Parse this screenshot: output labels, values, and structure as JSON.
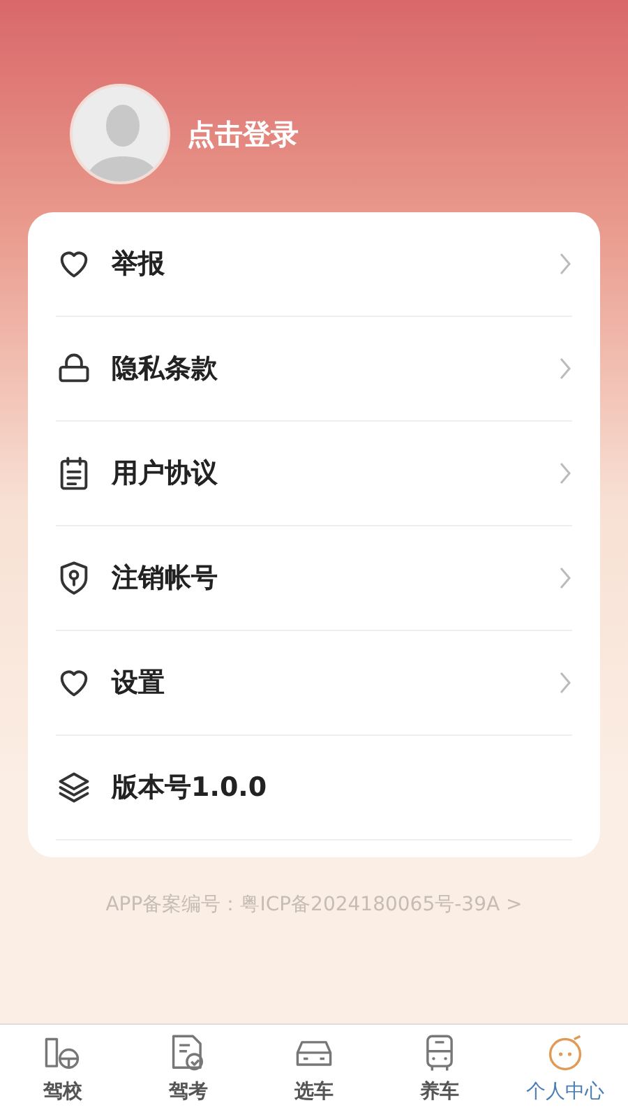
{
  "profile": {
    "login_label": "点击登录"
  },
  "menu": [
    {
      "kind": "heart",
      "label": "举报",
      "chevron": true
    },
    {
      "kind": "lock",
      "label": "隐私条款",
      "chevron": true
    },
    {
      "kind": "clipboard",
      "label": "用户协议",
      "chevron": true
    },
    {
      "kind": "shield",
      "label": "注销帐号",
      "chevron": true
    },
    {
      "kind": "heart",
      "label": "设置",
      "chevron": true
    },
    {
      "kind": "layers",
      "label": "版本号1.0.0",
      "chevron": false
    }
  ],
  "footer": {
    "icp_text": "APP备案编号：粤ICP备2024180065号-39A >"
  },
  "tab_bar": [
    {
      "kind": "school",
      "label": "驾校",
      "selected": false
    },
    {
      "kind": "exam",
      "label": "驾考",
      "selected": false
    },
    {
      "kind": "car",
      "label": "选车",
      "selected": false
    },
    {
      "kind": "bus",
      "label": "养车",
      "selected": false
    },
    {
      "kind": "face",
      "label": "个人中心",
      "selected": true
    }
  ]
}
